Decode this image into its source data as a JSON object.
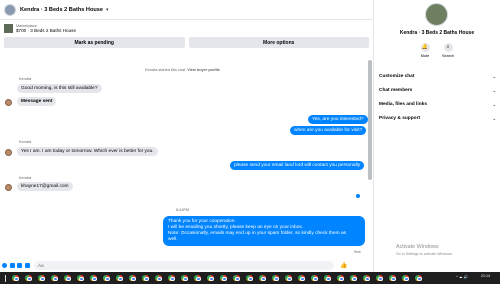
{
  "header": {
    "title": "Kendra · 3 Beds 2 Baths House",
    "chevron": "▾"
  },
  "listing": {
    "label": "Marketplace",
    "price_title": "$700 · 3 Beds 2 Baths House"
  },
  "actions": {
    "mark_pending": "Mark as pending",
    "more_options": "More options"
  },
  "system_message": {
    "prefix": "Kendra started this chat. ",
    "link": "View buyer profile"
  },
  "messages": [
    {
      "dir": "in",
      "sender": "Kendra",
      "text": "Good morning, is this still available?"
    },
    {
      "dir": "in",
      "text": "Message sent"
    },
    {
      "dir": "out",
      "text": "Yes, are you interested?"
    },
    {
      "dir": "out",
      "text": "when are you available for visit?"
    },
    {
      "dir": "in",
      "sender": "Kendra",
      "text": "Yes I am. I am today or tomorrow. Which ever is better for you."
    },
    {
      "dir": "out",
      "text": "please send your email land lord will contact you personally"
    },
    {
      "dir": "in",
      "sender": "Kendra",
      "text": "khayne17@gmail.com"
    },
    {
      "dir": "out",
      "lines": [
        "Thank you for your cooperation.",
        "I will be emailing you shortly, please keep an eye on your inbox.",
        "Note: Occasionally, emails may end up in your spam folder, so kindly check them as",
        "well."
      ]
    }
  ],
  "timestamp": "8:41PM",
  "sent_label": "Sent",
  "composer": {
    "placeholder": "Aa",
    "like": "👍"
  },
  "info": {
    "name": "Kendra · 3 Beds 2 Baths House",
    "quick_actions": [
      {
        "icon": "🔔",
        "label": "Mute"
      },
      {
        "icon": "⌕",
        "label": "Search"
      }
    ],
    "sections": [
      "Customize chat",
      "Chat members",
      "Media, files and links",
      "Privacy & support"
    ],
    "chevron": "⌄"
  },
  "watermark": {
    "title": "Activate Windows",
    "subtitle": "Go to Settings to activate Windows."
  },
  "taskbar": {
    "time": "21:14",
    "date": "",
    "tray": "^ ☁ 🔊"
  }
}
